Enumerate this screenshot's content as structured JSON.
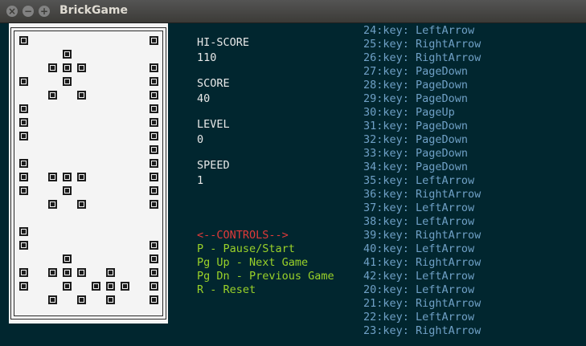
{
  "window": {
    "title": "BrickGame"
  },
  "info": {
    "hiscore_label": "HI-SCORE",
    "hiscore": "110",
    "score_label": "SCORE",
    "score": "40",
    "level_label": "LEVEL",
    "level": "0",
    "speed_label": "SPEED",
    "speed": "1"
  },
  "controls": {
    "header": "<--CONTROLS-->",
    "lines": [
      "P - Pause/Start",
      "Pg Up - Next Game",
      "Pg Dn - Previous Game",
      "R - Reset"
    ]
  },
  "log": [
    "24:key: LeftArrow",
    "25:key: RightArrow",
    "26:key: RightArrow",
    "27:key: PageDown",
    "28:key: PageDown",
    "29:key: PageDown",
    "30:key: PageUp",
    "31:key: PageDown",
    "32:key: PageDown",
    "33:key: PageDown",
    "34:key: PageDown",
    "35:key: LeftArrow",
    "36:key: RightArrow",
    "37:key: LeftArrow",
    "38:key: LeftArrow",
    "39:key: RightArrow",
    "40:key: LeftArrow",
    "41:key: RightArrow",
    "42:key: LeftArrow",
    "20:key: LeftArrow",
    "21:key: RightArrow",
    "22:key: LeftArrow",
    "23:key: RightArrow"
  ],
  "board": {
    "cells": [
      [
        0,
        0
      ],
      [
        9,
        0
      ],
      [
        3,
        1
      ],
      [
        2,
        2
      ],
      [
        3,
        2
      ],
      [
        4,
        2
      ],
      [
        9,
        2
      ],
      [
        0,
        3
      ],
      [
        3,
        3
      ],
      [
        9,
        3
      ],
      [
        2,
        4
      ],
      [
        4,
        4
      ],
      [
        9,
        4
      ],
      [
        0,
        5
      ],
      [
        9,
        5
      ],
      [
        0,
        6
      ],
      [
        9,
        6
      ],
      [
        0,
        7
      ],
      [
        9,
        7
      ],
      [
        9,
        8
      ],
      [
        0,
        9
      ],
      [
        9,
        9
      ],
      [
        0,
        10
      ],
      [
        2,
        10
      ],
      [
        3,
        10
      ],
      [
        4,
        10
      ],
      [
        9,
        10
      ],
      [
        0,
        11
      ],
      [
        3,
        11
      ],
      [
        9,
        11
      ],
      [
        2,
        12
      ],
      [
        4,
        12
      ],
      [
        9,
        12
      ],
      [
        0,
        14
      ],
      [
        0,
        15
      ],
      [
        9,
        15
      ],
      [
        3,
        16
      ],
      [
        9,
        16
      ],
      [
        0,
        17
      ],
      [
        2,
        17
      ],
      [
        3,
        17
      ],
      [
        4,
        17
      ],
      [
        6,
        17
      ],
      [
        9,
        17
      ],
      [
        0,
        18
      ],
      [
        3,
        18
      ],
      [
        5,
        18
      ],
      [
        6,
        18
      ],
      [
        7,
        18
      ],
      [
        9,
        18
      ],
      [
        2,
        19
      ],
      [
        4,
        19
      ],
      [
        6,
        19
      ],
      [
        9,
        19
      ]
    ]
  }
}
